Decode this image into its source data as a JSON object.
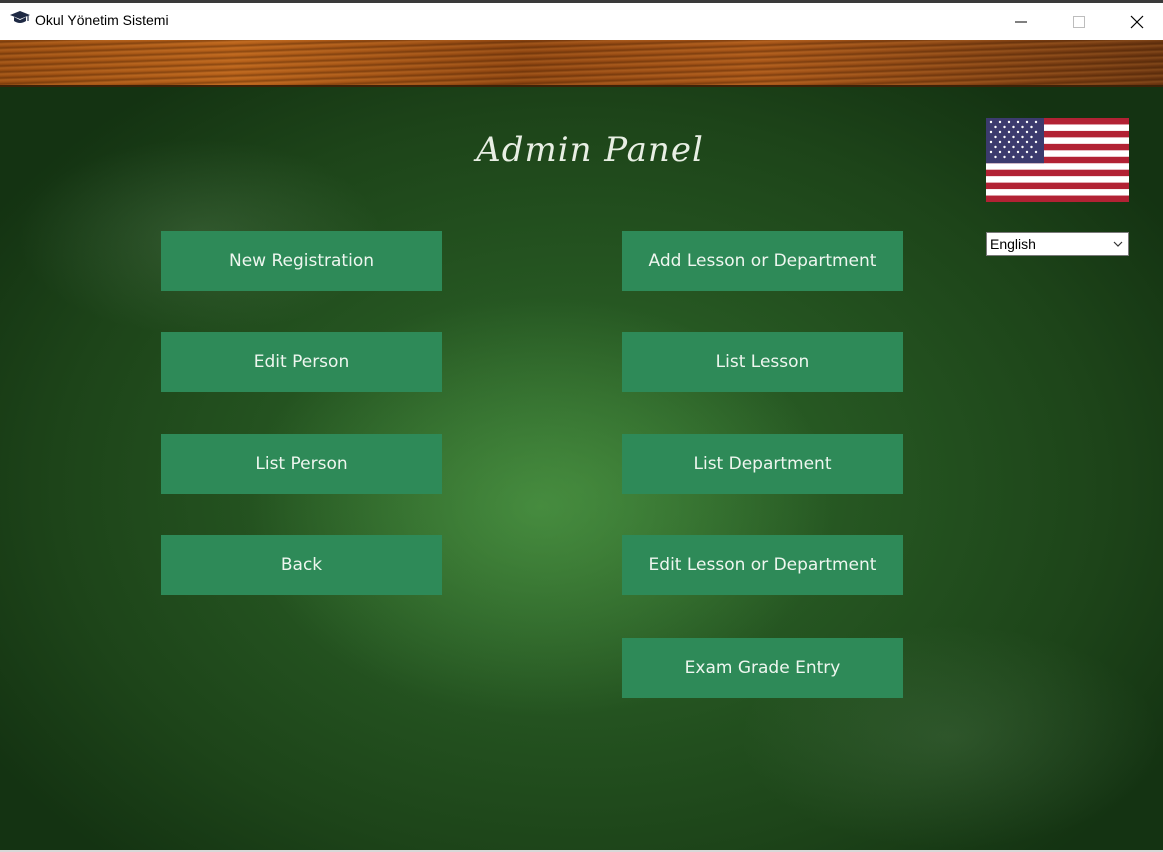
{
  "window": {
    "title": "Okul Yönetim Sistemi"
  },
  "panel": {
    "title": "Admin Panel"
  },
  "buttons": {
    "new_registration": "New Registration",
    "edit_person": "Edit Person",
    "list_person": "List Person",
    "back": "Back",
    "add_lesson_or_department": "Add Lesson or Department",
    "list_lesson": "List Lesson",
    "list_department": "List Department",
    "edit_lesson_or_department": "Edit Lesson or Department",
    "exam_grade_entry": "Exam Grade Entry"
  },
  "language": {
    "selected": "English",
    "flag_icon": "us-flag-icon"
  },
  "colors": {
    "button": "#2e8a58",
    "board": "#1d4419",
    "wood": "#a85618"
  }
}
